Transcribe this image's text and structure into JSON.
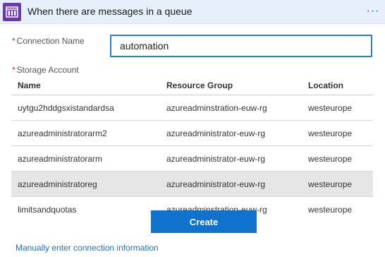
{
  "header": {
    "title": "When there are messages in a queue",
    "icon": "queue-icon",
    "more_label": "···",
    "icon_color": "#6b3aa8",
    "background": "#e7f0fa"
  },
  "form": {
    "connection_name_label": "Connection Name",
    "connection_name_value": "automation",
    "storage_account_label": "Storage Account",
    "required_marker": "*"
  },
  "table": {
    "columns": [
      "Name",
      "Resource Group",
      "Location"
    ],
    "rows": [
      {
        "name": "uytgu2hddgsxistandardsa",
        "resource_group": "azureadminstration-euw-rg",
        "location": "westeurope",
        "selected": false
      },
      {
        "name": "azureadministratorarm2",
        "resource_group": "azureadministrator-euw-rg",
        "location": "westeurope",
        "selected": false
      },
      {
        "name": "azureadministratorarm",
        "resource_group": "azureadministrator-euw-rg",
        "location": "westeurope",
        "selected": false
      },
      {
        "name": "azureadministratoreg",
        "resource_group": "azureadministrator-euw-rg",
        "location": "westeurope",
        "selected": true
      },
      {
        "name": "limitsandquotas",
        "resource_group": "azureadminstration-euw-rg",
        "location": "westeurope",
        "selected": false
      }
    ]
  },
  "actions": {
    "create_label": "Create",
    "manual_link": "Manually enter connection information",
    "accent": "#0f72cc"
  }
}
